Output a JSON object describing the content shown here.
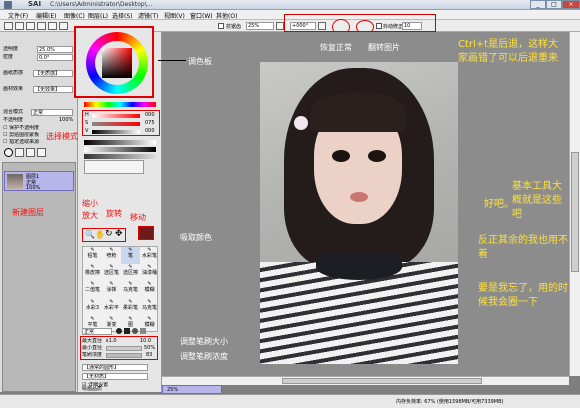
{
  "window": {
    "logo": "SAI",
    "title": "C:\\Users\\Administrator\\Desktop\\..."
  },
  "menu": [
    "文件(F)",
    "编辑(E)",
    "图像(C)",
    "图层(L)",
    "选择(S)",
    "滤镜(T)",
    "视图(V)",
    "窗口(W)",
    "其他(O)"
  ],
  "toolbar": {
    "anti_alias": "抗锯齿",
    "zoom": "25%",
    "angle": "+000°",
    "stabilizer_label": "抖动修正",
    "stabilizer_value": "10"
  },
  "layer_props": {
    "opacity_label": "透明度",
    "opacity_value": "25.0%",
    "density_label": "密度",
    "density_value": "0.0°",
    "texture_label": "画纸质感",
    "texture_value": "【无质感】",
    "effect_label": "画材效果",
    "effect_value": "【无效果】",
    "blend_label": "混合模式",
    "blend_value": "正常",
    "opacity2_label": "不透明度",
    "opacity2_value": "100%",
    "options": [
      "保护不透明度",
      "剪贴图层蒙板",
      "指定选取来源"
    ]
  },
  "layer": {
    "name": "图层1",
    "mode": "正常",
    "opacity": "100%"
  },
  "color": {
    "sliders": [
      {
        "letter": "H",
        "value": "000"
      },
      {
        "letter": "S",
        "value": "075"
      },
      {
        "letter": "V",
        "value": "000"
      }
    ],
    "main": "#6e1a1a"
  },
  "tools": [
    [
      "铅笔",
      "喷枪",
      "笔",
      "水彩笔"
    ],
    [
      "橡皮擦",
      "选区笔",
      "选区擦",
      "油漆桶"
    ],
    [
      "二值笔",
      "涂抹",
      "马克笔",
      "模糊"
    ],
    [
      "水彩3",
      "水彩平",
      "柔彩笔",
      "马克笔"
    ],
    [
      "平笔",
      "渐变",
      "图",
      "模糊"
    ]
  ],
  "brush": {
    "mode": "正常",
    "size_label": "最大直径",
    "size_mult": "x1.0",
    "size_value": "10.0",
    "min_label": "最小直径",
    "min_value": "50%",
    "density_label": "笔刷浓度",
    "density_value": "83",
    "shape": "【通常的圆形】",
    "texture": "【无材质】",
    "detail": "详细设置",
    "extra": "绘画品质"
  },
  "zoom_bar": "25%",
  "status": {
    "mem": "内存负荷率: 67% (使用1598MB/可用7339MB)"
  },
  "annotations": {
    "palette": "调色板",
    "restore": "恢复正常",
    "flip": "翻转图片",
    "blend": "选择模式",
    "new_layer": "新建图层",
    "zoom": "缩小 放大",
    "rotate": "旋转",
    "move": "移动",
    "eyedropper": "吸取颜色",
    "brush_size": "调整笔刷大小",
    "brush_density": "调整笔刷浓度"
  },
  "notes": [
    "Ctrl+t是后退，这样大家画错了可以后退重来",
    "基本工具大概就是这些吧",
    "好吧。",
    "反正其余的我也用不着",
    "要是我忘了，用的时候我会圈一下"
  ]
}
